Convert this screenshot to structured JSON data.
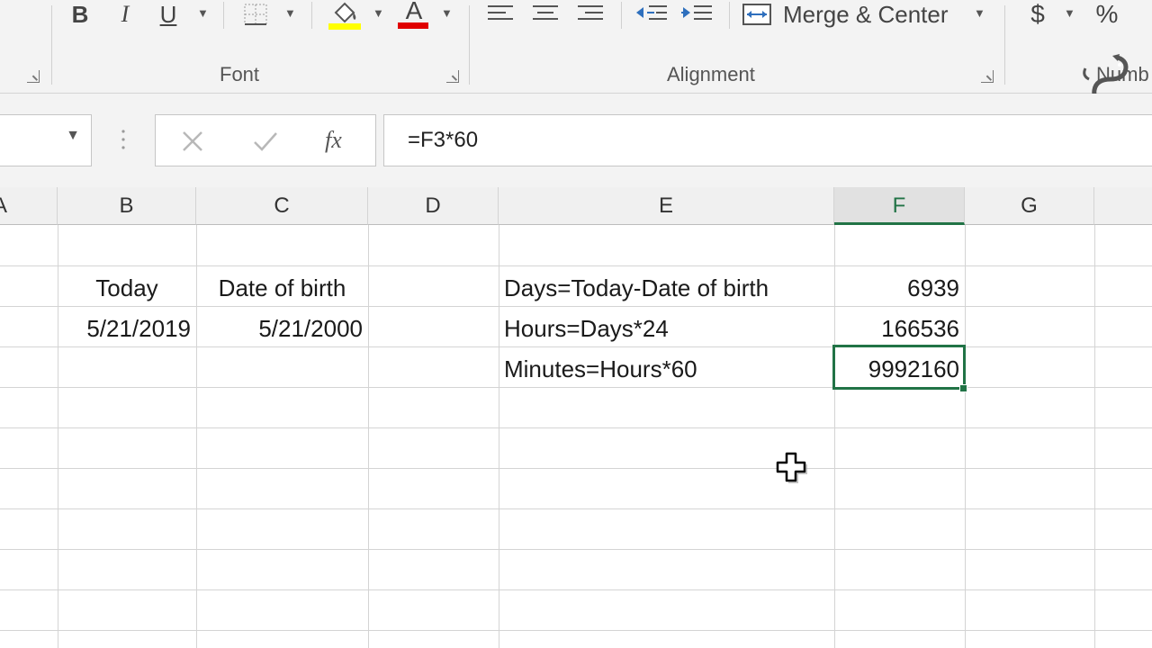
{
  "ribbon": {
    "font_group": {
      "label": "Font",
      "bold_label": "B",
      "italic_label": "I",
      "underline_label": "U",
      "font_color_label": "A",
      "highlight_color": "#ffff00",
      "font_color": "#e00000"
    },
    "alignment_group": {
      "label": "Alignment",
      "merge_center_label": "Merge & Center"
    },
    "number_group": {
      "label": "Numb",
      "currency_label": "$",
      "percent_label": "%"
    }
  },
  "formula_bar": {
    "name_box_value": "",
    "fx_label": "fx",
    "formula": "=F3*60"
  },
  "sheet": {
    "columns": [
      "A",
      "B",
      "C",
      "D",
      "E",
      "F",
      "G"
    ],
    "active_column": "F",
    "cells": {
      "B2": "Today",
      "C2": "Date of birth",
      "B3": "5/21/2019",
      "C3": "5/21/2000",
      "E2": "Days=Today-Date of birth",
      "E3": "Hours=Days*24",
      "E4": "Minutes=Hours*60",
      "F2": "6939",
      "F3": "166536",
      "F4": "9992160"
    },
    "selected_cell": "F4",
    "accent_color": "#217346"
  }
}
